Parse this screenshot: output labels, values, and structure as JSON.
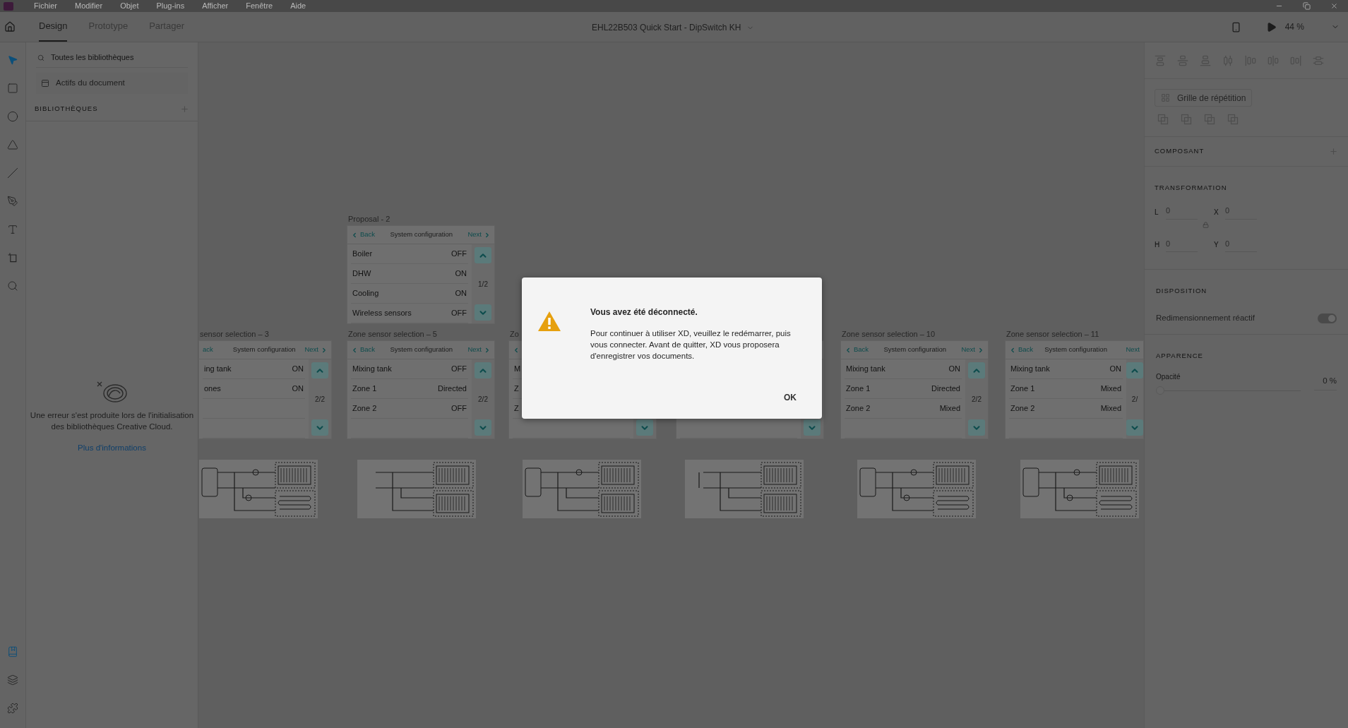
{
  "menu": [
    "Fichier",
    "Modifier",
    "Objet",
    "Plug-ins",
    "Afficher",
    "Fenêtre",
    "Aide"
  ],
  "toolbar": {
    "tabs": [
      {
        "label": "Design",
        "selected": true
      },
      {
        "label": "Prototype",
        "selected": false
      },
      {
        "label": "Partager",
        "selected": false
      }
    ],
    "document_title": "EHL22B503 Quick Start - DipSwitch KH",
    "zoom": "44 %"
  },
  "tools": [
    {
      "kind": "select",
      "selected": true
    },
    {
      "kind": "rectangle",
      "selected": false
    },
    {
      "kind": "ellipse",
      "selected": false
    },
    {
      "kind": "triangle",
      "selected": false
    },
    {
      "kind": "line",
      "selected": false
    },
    {
      "kind": "pen",
      "selected": false
    },
    {
      "kind": "text",
      "selected": false
    },
    {
      "kind": "artboard",
      "selected": false
    },
    {
      "kind": "zoom",
      "selected": false
    }
  ],
  "bottom_tools": [
    {
      "kind": "libraries",
      "selected": true
    },
    {
      "kind": "layers",
      "selected": false
    },
    {
      "kind": "plugins",
      "selected": false
    }
  ],
  "library_panel": {
    "search": {
      "placeholder": "Toutes les bibliothèques"
    },
    "document_assets": "Actifs du document",
    "section_title": "BIBLIOTHÈQUES",
    "error": "Une erreur s'est produite lors de l'initialisation des bibliothèques Creative Cloud.",
    "link": "Plus d'informations"
  },
  "artboards": [
    {
      "kind": "artboard",
      "label": "Proposal - 2",
      "back": "Back",
      "title": "System configuration",
      "next": "Next",
      "rows": [
        {
          "name": "Boiler",
          "value": "OFF"
        },
        {
          "name": "DHW",
          "value": "ON"
        },
        {
          "name": "Cooling",
          "value": "ON"
        },
        {
          "name": "Wireless sensors",
          "value": "OFF"
        }
      ],
      "page": "1/2"
    },
    {
      "kind": "artboard",
      "label": "sensor selection – 3",
      "back": "ack",
      "title": "System configuration",
      "next": "Next",
      "rows": [
        {
          "name": "ing tank",
          "value": "ON"
        },
        {
          "name": "ones",
          "value": "ON"
        }
      ],
      "page": "2/2"
    },
    {
      "kind": "artboard",
      "label": "Zone sensor selection – 5",
      "back": "Back",
      "title": "System configuration",
      "next": "Next",
      "rows": [
        {
          "name": "Mixing tank",
          "value": "OFF"
        },
        {
          "name": "Zone 1",
          "value": "Directed"
        },
        {
          "name": "Zone 2",
          "value": "OFF"
        }
      ],
      "page": "2/2"
    },
    {
      "kind": "artboard",
      "label": "Zo",
      "rows": [
        {
          "name": "M"
        },
        {
          "name": "Z"
        },
        {
          "name": "Z"
        }
      ]
    },
    {
      "kind": "artboard"
    },
    {
      "kind": "artboard",
      "label": "Zone sensor selection – 10",
      "back": "Back",
      "title": "System configuration",
      "next": "Next",
      "rows": [
        {
          "name": "Mixing tank",
          "value": "ON"
        },
        {
          "name": "Zone 1",
          "value": "Directed"
        },
        {
          "name": "Zone 2",
          "value": "Mixed"
        }
      ],
      "page": "2/2"
    },
    {
      "kind": "artboard",
      "label": "Zone sensor selection – 11",
      "back": "Back",
      "title": "System configuration",
      "next": "Next",
      "rows": [
        {
          "name": "Mixing tank",
          "value": "ON"
        },
        {
          "name": "Zone 1",
          "value": "Mixed"
        },
        {
          "name": "Zone 2",
          "value": "Mixed"
        }
      ],
      "page": "2/"
    }
  ],
  "schematics": [
    {
      "kind": "tank-floor"
    },
    {
      "kind": "two-radiators"
    },
    {
      "kind": "tank-radiators"
    },
    {
      "kind": "bypass-radiators"
    },
    {
      "kind": "tank-floor"
    },
    {
      "kind": "tank-floor"
    }
  ],
  "properties": {
    "repeat_grid": "Grille de répétition",
    "component": "COMPOSANT",
    "transform": {
      "title": "TRANSFORMATION",
      "fields": [
        {
          "label": "L",
          "value": "0"
        },
        {
          "label": "X",
          "value": "0"
        },
        {
          "label": "H",
          "value": "0"
        },
        {
          "label": "Y",
          "value": "0"
        }
      ]
    },
    "layout": {
      "title": "DISPOSITION",
      "responsive": {
        "label": "Redimensionnement réactif",
        "on": true
      }
    },
    "appearance": {
      "title": "APPARENCE",
      "opacity": {
        "label": "Opacité",
        "level": 0,
        "reading": "0 %"
      }
    }
  },
  "dialog": {
    "title": "Vous avez été déconnecté.",
    "message": "Pour continuer à utiliser XD, veuillez le redémarrer, puis vous connecter. Avant de quitter, XD vous proposera d'enregistrer vos documents.",
    "button": "OK"
  }
}
